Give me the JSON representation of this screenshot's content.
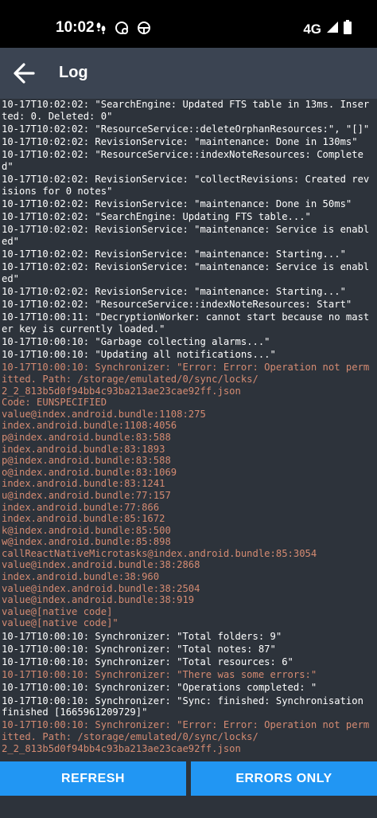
{
  "status_bar": {
    "time": "10:02",
    "network": "4G",
    "icons": [
      "footsteps-icon",
      "sync-badge-icon",
      "steering-icon",
      "signal-icon",
      "battery-icon"
    ]
  },
  "app_bar": {
    "title": "Log",
    "back_icon": "arrow-left-icon",
    "background": "#3b4452"
  },
  "colors": {
    "log_background": "#2d333b",
    "log_text": "#ffffff",
    "log_error_text": "#d58b72",
    "button": "#2196f3"
  },
  "log_entries": [
    {
      "text": "10-17T10:02:02: \"SearchEngine: Updated FTS table in 13ms. Inserted: 0. Deleted: 0\"",
      "level": "info"
    },
    {
      "text": "10-17T10:02:02: \"ResourceService::deleteOrphanResources:\", \"[]\"",
      "level": "info"
    },
    {
      "text": "10-17T10:02:02: RevisionService: \"maintenance: Done in 130ms\"",
      "level": "info"
    },
    {
      "text": "10-17T10:02:02: \"ResourceService::indexNoteResources: Completed\"",
      "level": "info"
    },
    {
      "text": "10-17T10:02:02: RevisionService: \"collectRevisions: Created revisions for 0 notes\"",
      "level": "info"
    },
    {
      "text": "10-17T10:02:02: RevisionService: \"maintenance: Done in 50ms\"",
      "level": "info"
    },
    {
      "text": "10-17T10:02:02: \"SearchEngine: Updating FTS table...\"",
      "level": "info"
    },
    {
      "text": "10-17T10:02:02: RevisionService: \"maintenance: Service is enabled\"",
      "level": "info"
    },
    {
      "text": "10-17T10:02:02: RevisionService: \"maintenance: Starting...\"",
      "level": "info"
    },
    {
      "text": "10-17T10:02:02: RevisionService: \"maintenance: Service is enabled\"",
      "level": "info"
    },
    {
      "text": "10-17T10:02:02: RevisionService: \"maintenance: Starting...\"",
      "level": "info"
    },
    {
      "text": "10-17T10:02:02: \"ResourceService::indexNoteResources: Start\"",
      "level": "info"
    },
    {
      "text": "10-17T10:00:11: \"DecryptionWorker: cannot start because no master key is currently loaded.\"",
      "level": "info"
    },
    {
      "text": "10-17T10:00:10: \"Garbage collecting alarms...\"",
      "level": "info"
    },
    {
      "text": "10-17T10:00:10: \"Updating all notifications...\"",
      "level": "info"
    },
    {
      "text": "10-17T10:00:10: Synchronizer: \"Error: Error: Operation not permitted. Path: /storage/emulated/0/sync/locks/\n2_2_813b5d0f94bb4c93ba213ae23cae92ff.json\nCode: EUNSPECIFIED\nvalue@index.android.bundle:1108:275\nindex.android.bundle:1108:4056\np@index.android.bundle:83:588\nindex.android.bundle:83:1893\np@index.android.bundle:83:588\no@index.android.bundle:83:1069\nindex.android.bundle:83:1241\nu@index.android.bundle:77:157\nindex.android.bundle:77:866\nindex.android.bundle:85:1672\nk@index.android.bundle:85:500\nw@index.android.bundle:85:898\ncallReactNativeMicrotasks@index.android.bundle:85:3054\nvalue@index.android.bundle:38:2868\nindex.android.bundle:38:960\nvalue@index.android.bundle:38:2504\nvalue@index.android.bundle:38:919\nvalue@[native code]\nvalue@[native code]\"",
      "level": "error"
    },
    {
      "text": "10-17T10:00:10: Synchronizer: \"Total folders: 9\"",
      "level": "info"
    },
    {
      "text": "10-17T10:00:10: Synchronizer: \"Total notes: 87\"",
      "level": "info"
    },
    {
      "text": "10-17T10:00:10: Synchronizer: \"Total resources: 6\"",
      "level": "info"
    },
    {
      "text": "10-17T10:00:10: Synchronizer: \"There was some errors:\"",
      "level": "error"
    },
    {
      "text": "10-17T10:00:10: Synchronizer: \"Operations completed: \"",
      "level": "info"
    },
    {
      "text": "10-17T10:00:10: Synchronizer: \"Sync: finished: Synchronisation finished [1665961209729]\"",
      "level": "info"
    },
    {
      "text": "10-17T10:00:10: Synchronizer: \"Error: Error: Operation not permitted. Path: /storage/emulated/0/sync/locks/\n2_2_813b5d0f94bb4c93ba213ae23cae92ff.json",
      "level": "error"
    }
  ],
  "buttons": {
    "refresh": "REFRESH",
    "errors_only": "ERRORS ONLY"
  }
}
